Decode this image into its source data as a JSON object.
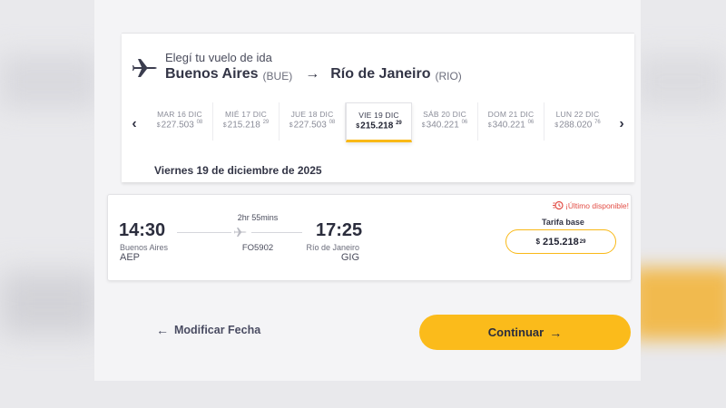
{
  "route": {
    "subtitle": "Elegí tu vuelo de ida",
    "origin_city": "Buenos Aires",
    "origin_code": "(BUE)",
    "arrow": "→",
    "destination_city": "Río de Janeiro",
    "destination_code": "(RIO)"
  },
  "date_strip": {
    "prev_icon": "‹",
    "next_icon": "›",
    "dates": [
      {
        "day": "MAR 16 DIC",
        "currency": "$",
        "price": "227.503",
        "cents": "08"
      },
      {
        "day": "MIÉ 17 DIC",
        "currency": "$",
        "price": "215.218",
        "cents": "29"
      },
      {
        "day": "JUE 18 DIC",
        "currency": "$",
        "price": "227.503",
        "cents": "08"
      },
      {
        "day": "VIE 19 DIC",
        "currency": "$",
        "price": "215.218",
        "cents": "29"
      },
      {
        "day": "SÁB 20 DIC",
        "currency": "$",
        "price": "340.221",
        "cents": "06"
      },
      {
        "day": "DOM 21 DIC",
        "currency": "$",
        "price": "340.221",
        "cents": "06"
      },
      {
        "day": "LUN 22 DIC",
        "currency": "$",
        "price": "288.020",
        "cents": "76"
      }
    ],
    "selected_index": 3
  },
  "selected_date_label": "Viernes 19 de diciembre de 2025",
  "flight": {
    "departure_time": "14:30",
    "departure_city": "Buenos Aires",
    "departure_code": "AEP",
    "duration": "2hr 55mins",
    "flight_number": "FO5902",
    "arrival_time": "17:25",
    "arrival_city": "Río de Janeiro",
    "arrival_code": "GIG",
    "availability": "¡Último disponible!",
    "fare_label": "Tarifa base",
    "fare_currency": "$",
    "fare_price": "215.218",
    "fare_cents": "29"
  },
  "actions": {
    "modify_icon": "←",
    "modify_label": "Modificar Fecha",
    "continue_label": "Continuar",
    "continue_icon": "→"
  },
  "colors": {
    "accent": "#fbbb1b",
    "alert": "#e24d45",
    "text_dark": "#2b2d3d"
  }
}
